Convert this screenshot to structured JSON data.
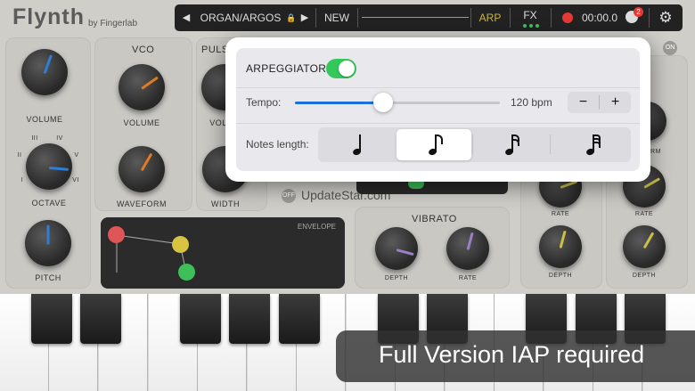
{
  "app": {
    "title": "Flynth",
    "byline": "by Fingerlab"
  },
  "topbar": {
    "preset_name": "ORGAN/ARGOS",
    "new_label": "NEW",
    "arp_label": "ARP",
    "fx_label": "FX",
    "time": "00:00.0",
    "badge_count": "2",
    "colors": {
      "arp": "#c9b640",
      "record": "#e53935",
      "fx_dots": "#3fbf5a"
    }
  },
  "panels": {
    "main": {
      "volume_label": "VOLUME",
      "octave_label": "OCTAVE",
      "octave_marks": [
        "III",
        "IV",
        "II",
        "V",
        "I",
        "VI"
      ],
      "pitch_label": "PITCH"
    },
    "vco": {
      "title": "VCO",
      "volume_label": "VOLUME",
      "waveform_label": "WAVEFORM"
    },
    "pulse": {
      "title": "PULSE",
      "volume_label": "VOL",
      "width_label": "WIDTH",
      "off_label": "OFF"
    },
    "envelope": {
      "title": "ENVELOPE"
    },
    "vibrato": {
      "title": "VIBRATO",
      "depth_label": "DEPTH",
      "rate_label": "RATE"
    },
    "right": {
      "rate_label": "RATE",
      "depth_label": "DEPTH",
      "rm_label": "RM",
      "on_label": "ON"
    }
  },
  "watermark": "UpdateStar.com",
  "arpeggiator": {
    "label": "ARPEGGIATOR",
    "enabled": true,
    "tempo_label": "Tempo:",
    "tempo_value": "120 bpm",
    "tempo_fraction": 0.43,
    "minus": "−",
    "plus": "+",
    "notes_label": "Notes length:",
    "note_options": [
      "♩",
      "♪",
      "𝅘𝅥𝅯",
      "𝅘𝅥𝅰"
    ],
    "selected_index": 1,
    "colors": {
      "toggle": "#34c759",
      "slider": "#1e6fd9"
    }
  },
  "banner": {
    "text": "Full Version IAP required"
  }
}
